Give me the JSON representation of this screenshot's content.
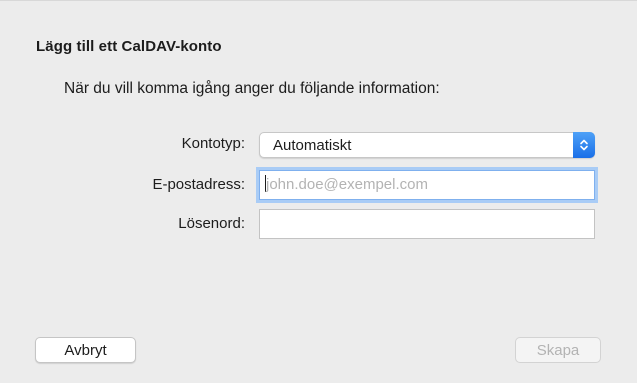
{
  "dialog": {
    "title": "Lägg till ett CalDAV-konto",
    "intro": "När du vill komma igång anger du följande information:"
  },
  "form": {
    "account_type": {
      "label": "Kontotyp:",
      "value": "Automatiskt"
    },
    "email": {
      "label": "E-postadress:",
      "placeholder": "john.doe@exempel.com",
      "value": ""
    },
    "password": {
      "label": "Lösenord:",
      "value": ""
    }
  },
  "buttons": {
    "cancel": "Avbryt",
    "create": "Skapa"
  },
  "icons": {
    "select_stepper": "chevron-up-down-icon"
  },
  "colors": {
    "accent": "#1a6fe8",
    "focus_ring": "#a9ccf6",
    "background": "#ececec"
  }
}
